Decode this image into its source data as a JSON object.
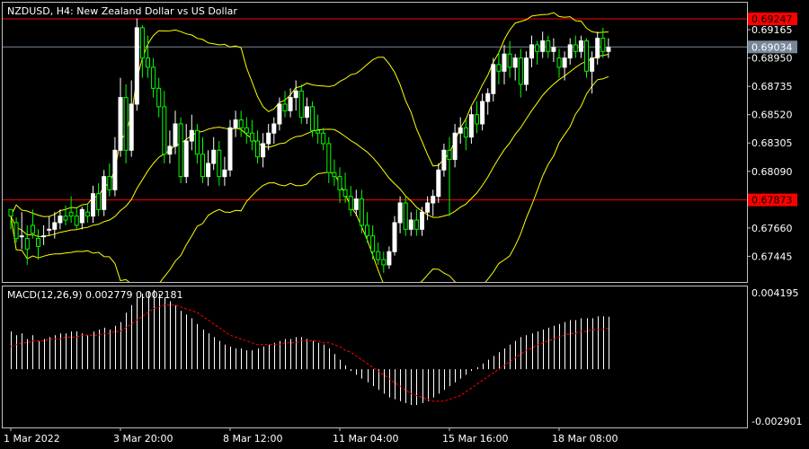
{
  "chart_data": [
    {
      "type": "candlestick",
      "title": "NZDUSD, H4:  New Zealand Dollar vs US Dollar",
      "ylim": [
        0.6725,
        0.6937
      ],
      "y_ticks": [
        "0.69165",
        "0.68950",
        "0.68735",
        "0.68520",
        "0.68305",
        "0.68090",
        "0.67660",
        "0.67445"
      ],
      "x_labels": [
        "1 Mar 2022",
        "3 Mar 20:00",
        "8 Mar 12:00",
        "11 Mar 04:00",
        "15 Mar 16:00",
        "18 Mar 08:00"
      ],
      "x_label_bars": [
        0,
        20,
        40,
        60,
        80,
        100
      ],
      "bar_count": 110,
      "horizontal_lines": [
        {
          "label": "0.69247",
          "value": 0.69247,
          "color": "#ff0000"
        },
        {
          "label": "0.67873",
          "value": 0.67873,
          "color": "#ff0000"
        }
      ],
      "current_price": {
        "label": "0.69034",
        "value": 0.69034,
        "color": "#778899"
      },
      "candles": [
        [
          0.678,
          0.6772,
          0.6765,
          0.6775
        ],
        [
          0.677,
          0.6774,
          0.6755,
          0.6758
        ],
        [
          0.676,
          0.6778,
          0.675,
          0.676
        ],
        [
          0.6758,
          0.6768,
          0.6738,
          0.675
        ],
        [
          0.6768,
          0.678,
          0.6758,
          0.6762
        ],
        [
          0.6758,
          0.6765,
          0.6742,
          0.6752
        ],
        [
          0.676,
          0.6768,
          0.6753,
          0.676
        ],
        [
          0.6765,
          0.6775,
          0.676,
          0.6765
        ],
        [
          0.6765,
          0.6778,
          0.6758,
          0.677
        ],
        [
          0.677,
          0.678,
          0.6765,
          0.6775
        ],
        [
          0.6775,
          0.6783,
          0.6768,
          0.6772
        ],
        [
          0.6778,
          0.679,
          0.677,
          0.6775
        ],
        [
          0.6775,
          0.6782,
          0.6765,
          0.6768
        ],
        [
          0.677,
          0.6782,
          0.6765,
          0.678
        ],
        [
          0.6778,
          0.6785,
          0.677,
          0.6775
        ],
        [
          0.6775,
          0.6798,
          0.677,
          0.6792
        ],
        [
          0.6792,
          0.68,
          0.6775,
          0.678
        ],
        [
          0.678,
          0.681,
          0.6775,
          0.6805
        ],
        [
          0.6805,
          0.6815,
          0.679,
          0.6795
        ],
        [
          0.6795,
          0.6835,
          0.679,
          0.6825
        ],
        [
          0.6825,
          0.688,
          0.682,
          0.6865
        ],
        [
          0.6865,
          0.6875,
          0.6815,
          0.6825
        ],
        [
          0.6825,
          0.6878,
          0.682,
          0.686
        ],
        [
          0.686,
          0.6925,
          0.6855,
          0.6918
        ],
        [
          0.6918,
          0.692,
          0.688,
          0.6895
        ],
        [
          0.6895,
          0.6912,
          0.688,
          0.6888
        ],
        [
          0.6888,
          0.6895,
          0.6865,
          0.6872
        ],
        [
          0.6872,
          0.688,
          0.685,
          0.6858
        ],
        [
          0.6858,
          0.687,
          0.6815,
          0.6822
        ],
        [
          0.6822,
          0.684,
          0.6815,
          0.6828
        ],
        [
          0.6828,
          0.6855,
          0.6822,
          0.6845
        ],
        [
          0.6845,
          0.685,
          0.68,
          0.6805
        ],
        [
          0.6805,
          0.6845,
          0.68,
          0.6832
        ],
        [
          0.6832,
          0.6852,
          0.6825,
          0.684
        ],
        [
          0.684,
          0.6845,
          0.6815,
          0.6822
        ],
        [
          0.6822,
          0.6835,
          0.68,
          0.6805
        ],
        [
          0.6805,
          0.6825,
          0.6798,
          0.6815
        ],
        [
          0.6815,
          0.6835,
          0.681,
          0.6825
        ],
        [
          0.6825,
          0.6832,
          0.6798,
          0.6805
        ],
        [
          0.6805,
          0.682,
          0.6798,
          0.681
        ],
        [
          0.681,
          0.6848,
          0.6805,
          0.6842
        ],
        [
          0.6842,
          0.6855,
          0.6835,
          0.6848
        ],
        [
          0.6848,
          0.6855,
          0.6835,
          0.6842
        ],
        [
          0.6842,
          0.685,
          0.683,
          0.6838
        ],
        [
          0.6838,
          0.6848,
          0.6825,
          0.6832
        ],
        [
          0.6832,
          0.684,
          0.6815,
          0.682
        ],
        [
          0.682,
          0.6838,
          0.6812,
          0.683
        ],
        [
          0.683,
          0.6845,
          0.6825,
          0.6838
        ],
        [
          0.6838,
          0.685,
          0.683,
          0.6845
        ],
        [
          0.6845,
          0.6865,
          0.684,
          0.686
        ],
        [
          0.686,
          0.687,
          0.685,
          0.6855
        ],
        [
          0.6855,
          0.6872,
          0.685,
          0.6865
        ],
        [
          0.6865,
          0.6878,
          0.6855,
          0.687
        ],
        [
          0.687,
          0.6875,
          0.6845,
          0.685
        ],
        [
          0.685,
          0.6865,
          0.6845,
          0.6858
        ],
        [
          0.6858,
          0.6862,
          0.6835,
          0.684
        ],
        [
          0.684,
          0.6852,
          0.683,
          0.6838
        ],
        [
          0.6838,
          0.6842,
          0.6825,
          0.683
        ],
        [
          0.683,
          0.6835,
          0.68,
          0.6808
        ],
        [
          0.6808,
          0.6818,
          0.6798,
          0.6805
        ],
        [
          0.6805,
          0.6812,
          0.6785,
          0.6795
        ],
        [
          0.6795,
          0.6808,
          0.6785,
          0.679
        ],
        [
          0.679,
          0.6798,
          0.6775,
          0.678
        ],
        [
          0.678,
          0.6795,
          0.6775,
          0.6788
        ],
        [
          0.6788,
          0.6795,
          0.6762,
          0.6768
        ],
        [
          0.6768,
          0.6778,
          0.6755,
          0.676
        ],
        [
          0.676,
          0.6768,
          0.6742,
          0.6748
        ],
        [
          0.6748,
          0.6755,
          0.6738,
          0.6742
        ],
        [
          0.6742,
          0.6748,
          0.6732,
          0.6738
        ],
        [
          0.6738,
          0.6752,
          0.6735,
          0.6748
        ],
        [
          0.6748,
          0.6775,
          0.6745,
          0.677
        ],
        [
          0.677,
          0.679,
          0.6762,
          0.6785
        ],
        [
          0.6785,
          0.679,
          0.676,
          0.6765
        ],
        [
          0.6765,
          0.6778,
          0.676,
          0.6772
        ],
        [
          0.6772,
          0.678,
          0.676,
          0.6765
        ],
        [
          0.6765,
          0.6782,
          0.676,
          0.6778
        ],
        [
          0.6778,
          0.679,
          0.6772,
          0.6785
        ],
        [
          0.6785,
          0.6795,
          0.6775,
          0.679
        ],
        [
          0.679,
          0.6815,
          0.6785,
          0.681
        ],
        [
          0.681,
          0.683,
          0.6805,
          0.6825
        ],
        [
          0.6825,
          0.6835,
          0.6775,
          0.6818
        ],
        [
          0.6818,
          0.6845,
          0.6812,
          0.6838
        ],
        [
          0.6838,
          0.685,
          0.683,
          0.6842
        ],
        [
          0.6842,
          0.6848,
          0.6825,
          0.6835
        ],
        [
          0.6835,
          0.6858,
          0.683,
          0.6852
        ],
        [
          0.6852,
          0.6862,
          0.6838,
          0.6845
        ],
        [
          0.6845,
          0.6868,
          0.684,
          0.6862
        ],
        [
          0.6862,
          0.6872,
          0.6852,
          0.6868
        ],
        [
          0.6868,
          0.6895,
          0.6862,
          0.689
        ],
        [
          0.689,
          0.69,
          0.6875,
          0.6885
        ],
        [
          0.6885,
          0.6905,
          0.6875,
          0.6898
        ],
        [
          0.6898,
          0.6908,
          0.688,
          0.6888
        ],
        [
          0.6888,
          0.6898,
          0.6878,
          0.6895
        ],
        [
          0.6895,
          0.6902,
          0.6865,
          0.6875
        ],
        [
          0.6875,
          0.69,
          0.687,
          0.6895
        ],
        [
          0.6895,
          0.6912,
          0.6888,
          0.6905
        ],
        [
          0.6905,
          0.6908,
          0.689,
          0.69
        ],
        [
          0.69,
          0.6915,
          0.6895,
          0.6908
        ],
        [
          0.6908,
          0.6912,
          0.6895,
          0.69
        ],
        [
          0.69,
          0.691,
          0.6892,
          0.6903
        ],
        [
          0.6895,
          0.6902,
          0.688,
          0.6888
        ],
        [
          0.6888,
          0.69,
          0.6878,
          0.6895
        ],
        [
          0.6895,
          0.691,
          0.689,
          0.6905
        ],
        [
          0.6905,
          0.6912,
          0.6895,
          0.69
        ],
        [
          0.69,
          0.6912,
          0.6895,
          0.6908
        ],
        [
          0.6908,
          0.691,
          0.688,
          0.6885
        ],
        [
          0.6885,
          0.69,
          0.6868,
          0.6895
        ],
        [
          0.6895,
          0.6915,
          0.689,
          0.691
        ],
        [
          0.691,
          0.6918,
          0.6895,
          0.69
        ],
        [
          0.69,
          0.691,
          0.6895,
          0.6903
        ]
      ],
      "colors": {
        "bull": "#ffffff",
        "bear": "#00ff00",
        "band": "#ffff00",
        "grid": "#c0c0c0"
      }
    },
    {
      "type": "histogram",
      "title": "MACD(12,26,9) 0.002779 0.002181",
      "ylim": [
        -0.002901,
        0.004195
      ],
      "y_ticks": [
        "0.004195",
        "-0.002901"
      ],
      "macd": [
        0.002,
        0.0018,
        0.0019,
        0.0016,
        0.0018,
        0.0015,
        0.0016,
        0.0017,
        0.0018,
        0.0019,
        0.0019,
        0.002,
        0.002,
        0.0019,
        0.0018,
        0.002,
        0.0021,
        0.0022,
        0.0021,
        0.0023,
        0.0025,
        0.003,
        0.0034,
        0.0038,
        0.004,
        0.0041,
        0.0042,
        0.004,
        0.0038,
        0.0036,
        0.0034,
        0.0031,
        0.0029,
        0.0027,
        0.0024,
        0.0021,
        0.0019,
        0.0017,
        0.0015,
        0.0013,
        0.0012,
        0.0011,
        0.0011,
        0.001,
        0.001,
        0.0011,
        0.0012,
        0.0013,
        0.0014,
        0.0015,
        0.0016,
        0.0016,
        0.0017,
        0.0017,
        0.0016,
        0.0015,
        0.0014,
        0.0013,
        0.0011,
        0.0008,
        0.0005,
        0.0002,
        -0.0001,
        -0.0003,
        -0.0005,
        -0.0007,
        -0.0009,
        -0.0011,
        -0.0013,
        -0.0015,
        -0.0016,
        -0.0017,
        -0.0018,
        -0.0019,
        -0.0019,
        -0.0018,
        -0.0017,
        -0.0015,
        -0.0013,
        -0.0011,
        -0.0009,
        -0.0007,
        -0.0005,
        -0.0003,
        -0.0001,
        0.0001,
        0.0003,
        0.0005,
        0.0007,
        0.0009,
        0.0011,
        0.0013,
        0.0015,
        0.0017,
        0.0018,
        0.0019,
        0.002,
        0.0021,
        0.0022,
        0.0023,
        0.0024,
        0.0025,
        0.0026,
        0.0026,
        0.0027,
        0.0027,
        0.0027,
        0.0028,
        0.0028,
        0.002779
      ],
      "signal": [
        0.0012,
        0.0013,
        0.0014,
        0.0014,
        0.0015,
        0.0015,
        0.0015,
        0.0016,
        0.0016,
        0.0016,
        0.0017,
        0.0017,
        0.0017,
        0.0018,
        0.0018,
        0.0018,
        0.0018,
        0.0019,
        0.0019,
        0.002,
        0.002,
        0.0022,
        0.0024,
        0.0026,
        0.0028,
        0.003,
        0.0032,
        0.0033,
        0.0034,
        0.0034,
        0.0034,
        0.0033,
        0.0032,
        0.0031,
        0.003,
        0.0028,
        0.0026,
        0.0024,
        0.0022,
        0.002,
        0.0018,
        0.0017,
        0.0016,
        0.0015,
        0.0014,
        0.0013,
        0.0013,
        0.0013,
        0.0013,
        0.0013,
        0.0014,
        0.0014,
        0.0014,
        0.0015,
        0.0015,
        0.0015,
        0.0015,
        0.0014,
        0.0014,
        0.0013,
        0.0012,
        0.001,
        0.0009,
        0.0007,
        0.0005,
        0.0003,
        0.0001,
        -0.0001,
        -0.0003,
        -0.0005,
        -0.0007,
        -0.0009,
        -0.0011,
        -0.0013,
        -0.0014,
        -0.0015,
        -0.0016,
        -0.0017,
        -0.0017,
        -0.0017,
        -0.0016,
        -0.0015,
        -0.0014,
        -0.0012,
        -0.001,
        -0.0008,
        -0.0006,
        -0.0004,
        -0.0002,
        0.0,
        0.0002,
        0.0004,
        0.0006,
        0.0008,
        0.001,
        0.0011,
        0.0013,
        0.0014,
        0.0015,
        0.0016,
        0.0017,
        0.0018,
        0.0019,
        0.0019,
        0.002,
        0.002,
        0.0021,
        0.0021,
        0.0021,
        0.002181
      ],
      "colors": {
        "histogram": "#ffffff",
        "signal": "#ff0000"
      }
    }
  ]
}
